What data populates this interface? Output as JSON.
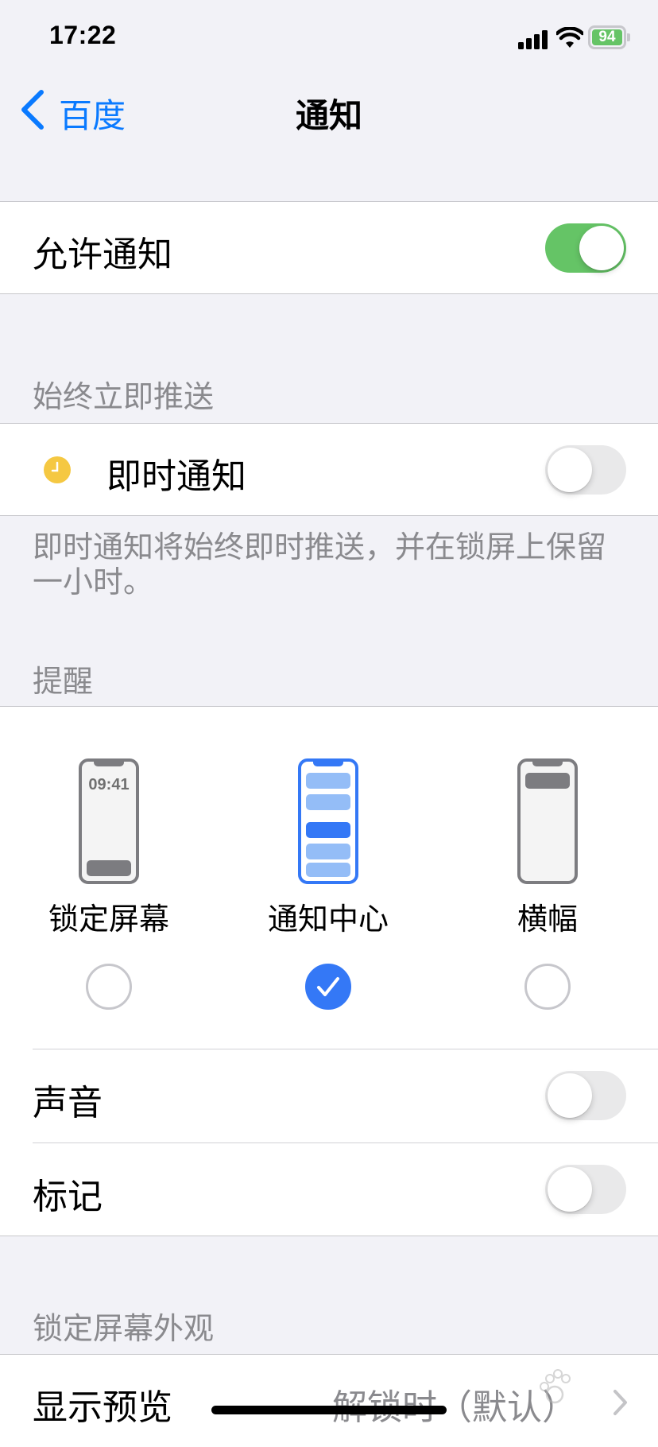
{
  "status_bar": {
    "time": "17:22",
    "battery": "94"
  },
  "nav": {
    "back_label": "百度",
    "title": "通知"
  },
  "allow": {
    "label": "允许通知",
    "on": true
  },
  "immediate": {
    "header": "始终立即推送",
    "label": "即时通知",
    "on": false,
    "footer": "即时通知将始终即时推送，并在锁屏上保留一小时。"
  },
  "alerts": {
    "header": "提醒",
    "options": [
      {
        "label": "锁定屏幕",
        "selected": false,
        "preview_time": "09:41"
      },
      {
        "label": "通知中心",
        "selected": true
      },
      {
        "label": "横幅",
        "selected": false
      }
    ],
    "sounds_label": "声音",
    "sounds_on": false,
    "badges_label": "标记",
    "badges_on": false
  },
  "lock_screen": {
    "header": "锁定屏幕外观",
    "show_previews_label": "显示预览",
    "show_previews_value": "解锁时（默认）"
  },
  "colors": {
    "accent_blue": "#0a7aff",
    "toggle_green": "#65c466",
    "selection_blue": "#3478f6",
    "time_sensitive_yellow": "#f5c842"
  }
}
